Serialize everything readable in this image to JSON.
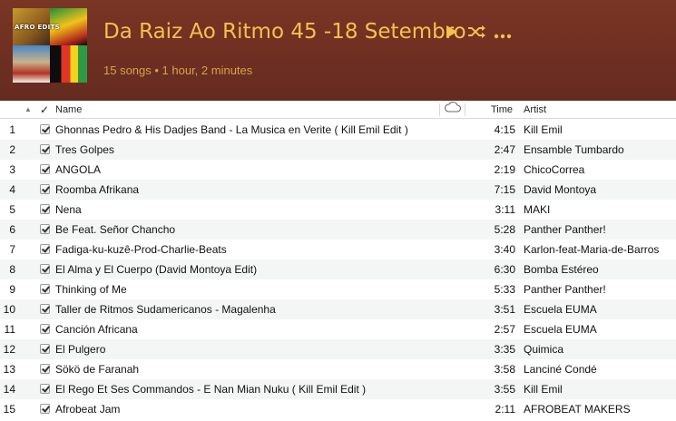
{
  "playlist": {
    "title": "Da Raiz Ao Ritmo 45 -18 Setembro",
    "summary": "15 songs • 1 hour, 2 minutes",
    "artwork_text": "AFRO EDITS",
    "colors": {
      "header_bg": "#6e2f22",
      "title": "#f2c14e",
      "subtitle": "#d9a24a"
    }
  },
  "header_icons": {
    "play": "play-icon",
    "shuffle": "shuffle-icon",
    "more": "more-icon"
  },
  "columns": {
    "sort": "▲",
    "check": "✓",
    "name": "Name",
    "cloud": "cloud-icon",
    "time": "Time",
    "artist": "Artist"
  },
  "tracks": [
    {
      "num": "1",
      "name": "Ghonnas Pedro & His Dadjes Band - La Musica en Verite ( Kill Emil Edit )",
      "time": "4:15",
      "artist": "Kill Emil"
    },
    {
      "num": "2",
      "name": "Tres Golpes",
      "time": "2:47",
      "artist": "Ensamble Tumbardo"
    },
    {
      "num": "3",
      "name": "ANGOLA",
      "time": "2:19",
      "artist": "ChicoCorrea"
    },
    {
      "num": "4",
      "name": "Roomba Afrikana",
      "time": "7:15",
      "artist": "David Montoya"
    },
    {
      "num": "5",
      "name": "Nena",
      "time": "3:11",
      "artist": "MAKI"
    },
    {
      "num": "6",
      "name": "Be Feat. Señor Chancho",
      "time": "5:28",
      "artist": "Panther Panther!"
    },
    {
      "num": "7",
      "name": "Fadiga-ku-kuzê-Prod-Charlie-Beats",
      "time": "3:40",
      "artist": "Karlon-feat-Maria-de-Barros"
    },
    {
      "num": "8",
      "name": "El Alma y El Cuerpo (David Montoya Edit)",
      "time": "6:30",
      "artist": "Bomba Estéreo"
    },
    {
      "num": "9",
      "name": "Thinking of Me",
      "time": "5:33",
      "artist": "Panther Panther!"
    },
    {
      "num": "10",
      "name": "Taller de Ritmos Sudamericanos - Magalenha",
      "time": "3:51",
      "artist": "Escuela EUMA"
    },
    {
      "num": "11",
      "name": "Canción Africana",
      "time": "2:57",
      "artist": "Escuela EUMA"
    },
    {
      "num": "12",
      "name": "El Pulgero",
      "time": "3:35",
      "artist": "Quimica"
    },
    {
      "num": "13",
      "name": "Sökö de Faranah",
      "time": "3:58",
      "artist": "Lanciné Condé"
    },
    {
      "num": "14",
      "name": "El Rego Et Ses Commandos - E Nan Mian Nuku ( Kill Emil Edit )",
      "time": "3:55",
      "artist": "Kill Emil"
    },
    {
      "num": "15",
      "name": "Afrobeat Jam",
      "time": "2:11",
      "artist": "AFROBEAT MAKERS"
    }
  ]
}
